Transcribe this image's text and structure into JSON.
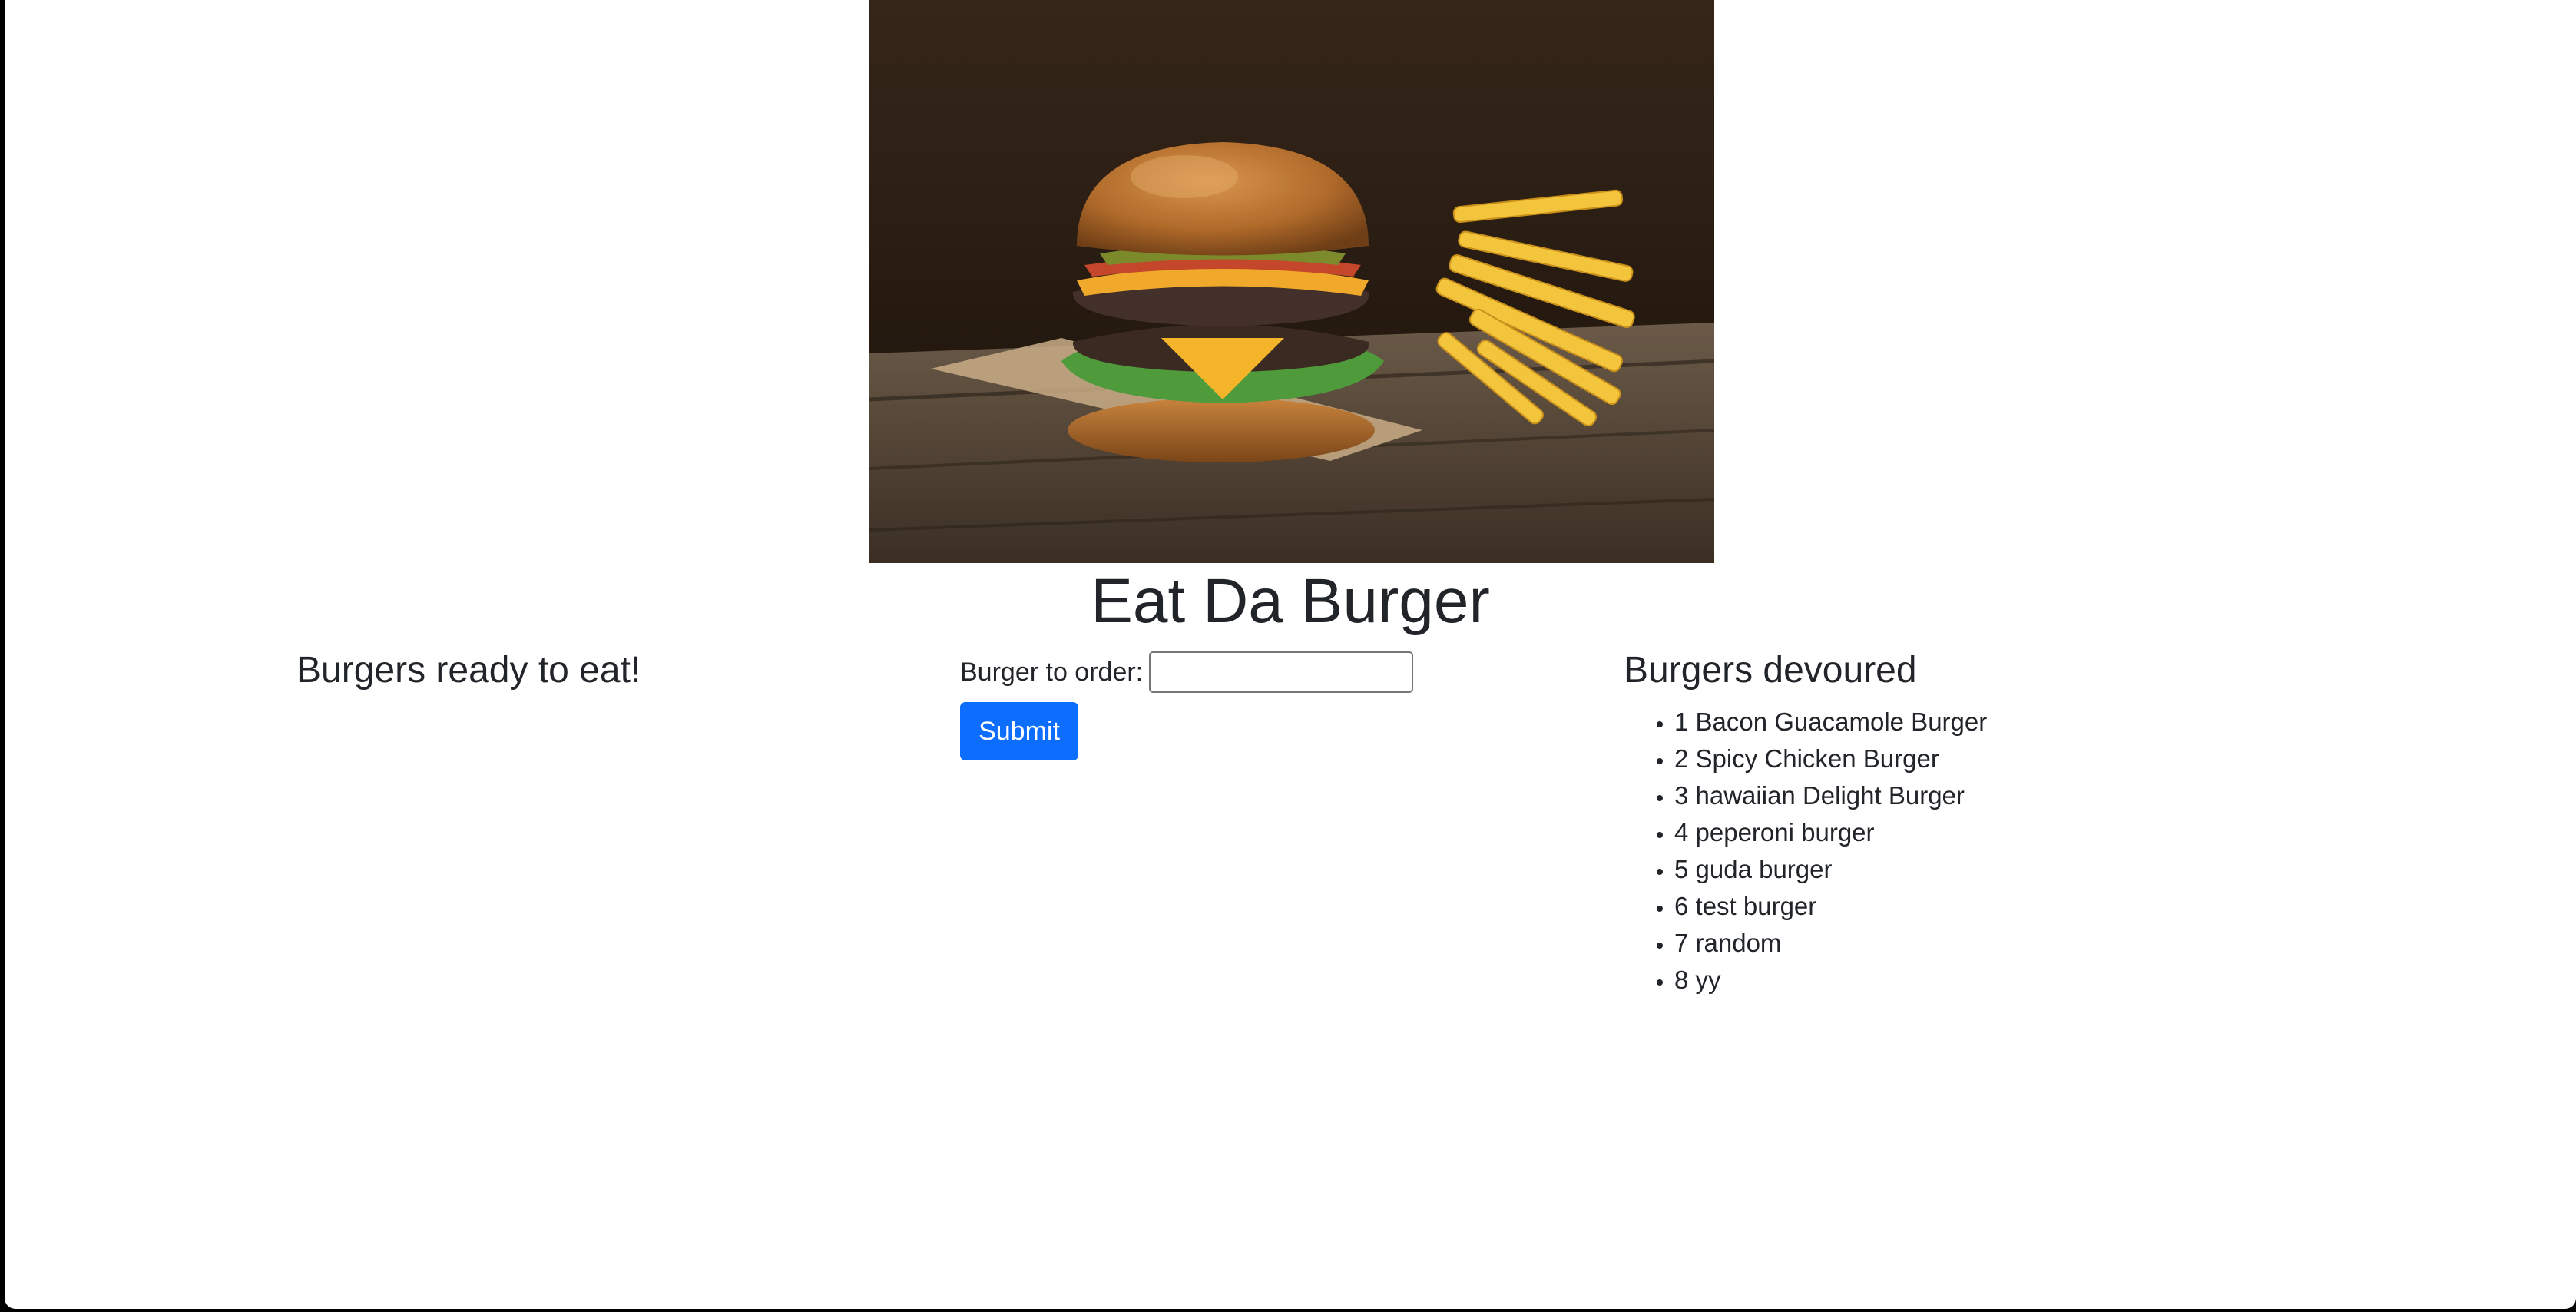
{
  "page": {
    "title": "Eat Da Burger"
  },
  "hero_image": {
    "alt": "Double cheeseburger with fries on a wooden board"
  },
  "ready_column": {
    "heading": "Burgers ready to eat!",
    "items": []
  },
  "order_form": {
    "label": "Burger to order:",
    "input_value": "",
    "submit_label": "Submit"
  },
  "devoured_column": {
    "heading": "Burgers devoured",
    "items": [
      "1 Bacon Guacamole Burger",
      "2 Spicy Chicken Burger",
      "3 hawaiian Delight Burger",
      "4 peperoni burger",
      "5 guda burger",
      "6 test burger",
      "7 random",
      "8 yy"
    ]
  },
  "colors": {
    "primary": "#0d6efd",
    "text": "#212529",
    "background": "#ffffff"
  }
}
